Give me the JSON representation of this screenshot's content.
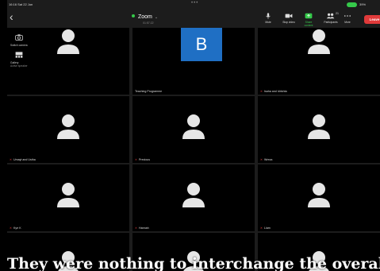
{
  "status_bar": {
    "time": "16:16  Sat 22 Jun",
    "battery": "39%"
  },
  "toolbar": {
    "meeting_title": "Zoom",
    "meeting_duration": "01:57:22",
    "buttons": [
      {
        "label": "Mute",
        "icon": "microphone-icon"
      },
      {
        "label": "Stop video",
        "icon": "video-camera-icon"
      },
      {
        "label": "Share content",
        "icon": "share-screen-icon"
      },
      {
        "label": "Participants",
        "icon": "participants-icon",
        "count": "21"
      },
      {
        "label": "More",
        "icon": "more-dots-icon"
      }
    ],
    "leave_label": "Leave"
  },
  "side_controls": {
    "switch_camera": "Switch camera",
    "gallery_label": "Gallery",
    "gallery_sub": "Active speaker"
  },
  "active_speaker": {
    "initial": "B",
    "color": "#1f6fc4"
  },
  "tiles": [
    {
      "name": "",
      "muted": false
    },
    {
      "name": "Teaching Programme",
      "muted": false
    },
    {
      "name": "Isaha and Idrishta",
      "muted": true
    },
    {
      "name": "Umayt and Ustha",
      "muted": true
    },
    {
      "name": "Precious",
      "muted": true
    },
    {
      "name": "Wreza",
      "muted": true
    },
    {
      "name": "Kye K",
      "muted": true
    },
    {
      "name": "Hannah",
      "muted": true
    },
    {
      "name": "Liam",
      "muted": true
    },
    {
      "name": "",
      "muted": false
    },
    {
      "name": "",
      "muted": false
    },
    {
      "name": "",
      "muted": false
    }
  ],
  "caption": "They were nothing to interchange the overall..."
}
